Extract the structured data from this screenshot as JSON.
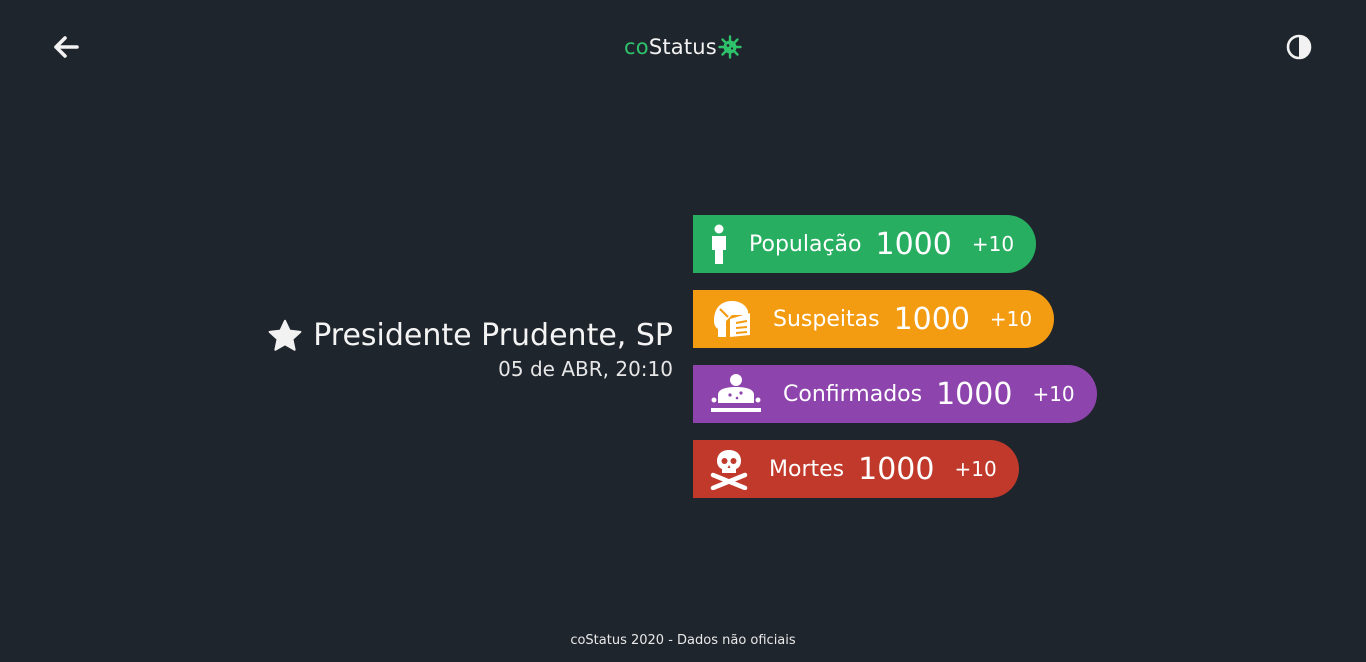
{
  "header": {
    "brand_prefix": "co",
    "brand_suffix": "Status",
    "back_icon": "arrow-left-icon",
    "theme_icon": "contrast-icon"
  },
  "colors": {
    "background": "#1f252d",
    "brand_green": "#2ec26a",
    "populacao": "#27ae60",
    "suspeitas": "#f39c12",
    "confirmados": "#8e44ad",
    "mortes": "#c0392b"
  },
  "location": {
    "name": "Presidente Prudente, SP",
    "updated": "05 de ABR, 20:10",
    "favorite_icon": "star-icon"
  },
  "stats": [
    {
      "key": "populacao",
      "label": "População",
      "value": "1000",
      "delta": "+10",
      "icon": "person-icon"
    },
    {
      "key": "suspeitas",
      "label": "Suspeitas",
      "value": "1000",
      "delta": "+10",
      "icon": "masked-head-icon"
    },
    {
      "key": "confirmados",
      "label": "Confirmados",
      "value": "1000",
      "delta": "+10",
      "icon": "sick-person-icon"
    },
    {
      "key": "mortes",
      "label": "Mortes",
      "value": "1000",
      "delta": "+10",
      "icon": "skull-crossbones-icon"
    }
  ],
  "footer": {
    "text": "coStatus 2020 - Dados não oficiais"
  }
}
